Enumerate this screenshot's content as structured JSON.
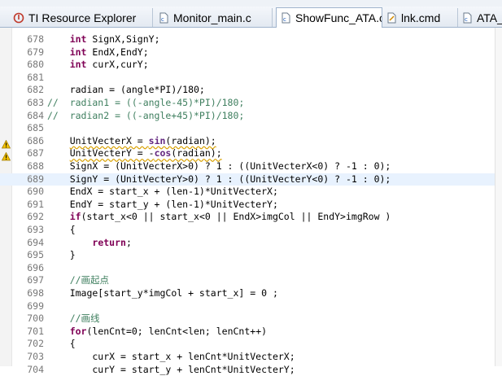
{
  "tabs": [
    {
      "label": "TI Resource Explorer",
      "icon": "ti-resource-icon",
      "active": false
    },
    {
      "label": "Monitor_main.c",
      "icon": "c-file-icon",
      "active": false
    },
    {
      "label": "ShowFunc_ATA.c",
      "icon": "c-file-icon",
      "active": true,
      "close": "⊠"
    },
    {
      "label": "lnk.cmd",
      "icon": "linker-file-icon",
      "active": false
    },
    {
      "label": "ATA_M",
      "icon": "c-file-icon",
      "active": false
    }
  ],
  "lines": [
    {
      "n": "678",
      "code": "    int SignX,SignY;"
    },
    {
      "n": "679",
      "code": "    int EndX,EndY;"
    },
    {
      "n": "680",
      "code": "    int curX,curY;"
    },
    {
      "n": "681",
      "code": ""
    },
    {
      "n": "682",
      "code": "    radian = (angle*PI)/180;"
    },
    {
      "n": "683",
      "code": "//  radian1 = ((-angle-45)*PI)/180;"
    },
    {
      "n": "684",
      "code": "//  radian2 = ((-angle+45)*PI)/180;"
    },
    {
      "n": "685",
      "code": ""
    },
    {
      "n": "686",
      "code": "    UnitVecterX = sin(radian);",
      "warn": true
    },
    {
      "n": "687",
      "code": "    UnitVecterY = -cos(radian);",
      "warn": true
    },
    {
      "n": "688",
      "code": "    SignX = (UnitVecterX>0) ? 1 : ((UnitVecterX<0) ? -1 : 0);"
    },
    {
      "n": "689",
      "code": "    SignY = (UnitVecterY>0) ? 1 : ((UnitVecterY<0) ? -1 : 0);",
      "hl": true
    },
    {
      "n": "690",
      "code": "    EndX = start_x + (len-1)*UnitVecterX;"
    },
    {
      "n": "691",
      "code": "    EndY = start_y + (len-1)*UnitVecterY;"
    },
    {
      "n": "692",
      "code": "    if(start_x<0 || start_x<0 || EndX>imgCol || EndY>imgRow )"
    },
    {
      "n": "693",
      "code": "    {"
    },
    {
      "n": "694",
      "code": "        return;"
    },
    {
      "n": "695",
      "code": "    }"
    },
    {
      "n": "696",
      "code": ""
    },
    {
      "n": "697",
      "code": "    //画起点"
    },
    {
      "n": "698",
      "code": "    Image[start_y*imgCol + start_x] = 0 ;"
    },
    {
      "n": "699",
      "code": ""
    },
    {
      "n": "700",
      "code": "    //画线"
    },
    {
      "n": "701",
      "code": "    for(lenCnt=0; lenCnt<len; lenCnt++)"
    },
    {
      "n": "702",
      "code": "    {"
    },
    {
      "n": "703",
      "code": "        curX = start_x + lenCnt*UnitVecterX;"
    },
    {
      "n": "704",
      "code": "        curY = start_y + lenCnt*UnitVecterY;"
    }
  ],
  "colors": {
    "keyword": "#7f0055",
    "comment": "#3f7f5f",
    "line_highlight": "#e8f2fe",
    "line_number": "#787878"
  }
}
